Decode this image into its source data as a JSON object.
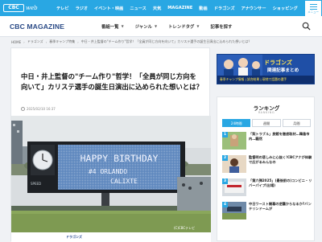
{
  "logo": {
    "box": "CBC",
    "web": "web"
  },
  "topnav": [
    "テレビ",
    "ラジオ",
    "イベント・映画",
    "ニュース",
    "天気",
    "MAGAZINE",
    "動画",
    "ドラゴンズ",
    "アナウンサー",
    "ショッピング"
  ],
  "menu": {
    "label": "メニュー"
  },
  "brand": "CBC MAGAZINE",
  "subnav": [
    {
      "label": "番組一覧"
    },
    {
      "label": "ジャンル"
    },
    {
      "label": "トレンドタグ"
    },
    {
      "label": "記事を探す"
    }
  ],
  "breadcrumbs": [
    "HOME",
    "ドラゴンズ",
    "春季キャンプ特集",
    "中日・井上監督の\"チーム作り\"哲学！「全員が同じ方向を向いて」カリステ選手の誕生日演出に込められた想いとは？"
  ],
  "article": {
    "headline": "中日・井上監督の\"チーム作り\"哲学！「全員が同じ方向を向いて」カリステ選手の誕生日演出に込められた想いとは？",
    "date": "2025/02/10 16:37",
    "scoreboard_line1": "HAPPY BIRTHDAY",
    "scoreboard_line2": "#4  ORLANDO",
    "scoreboard_line3": "CALIXTE",
    "watermark": "(C)CBCテレビ",
    "footer_logo": "ドラゴンズ"
  },
  "banner": {
    "title": "ドラゴンズ",
    "subtitle": "関連記事まとめ",
    "strip": "春季キャンプ情報 | 試合結果 | 現地で話題の選手"
  },
  "ranking": {
    "title": "ランキング",
    "subtitle": "RANKING",
    "tabs": [
      "24時間",
      "週間",
      "月間"
    ],
    "active_tab": 0,
    "items": [
      {
        "rank": "1",
        "text": "「契トラブル」旅館を徹底取材…韓島市内…騒然"
      },
      {
        "rank": "2",
        "text": "監督明の悲しみに心抜く!CBCアナが体験で広がるみんなの"
      },
      {
        "rank": "3",
        "text": "「第六弾2025」(最後前の)コンビニ・リバーパイプ(出場)"
      },
      {
        "rank": "4",
        "text": "中日ワースト開幕の逆襲からなるか?バンテリンドームが"
      }
    ]
  },
  "colors": {
    "primary": "#29a7e3",
    "brand": "#2a4a86",
    "banner": "#1f4fa6"
  }
}
